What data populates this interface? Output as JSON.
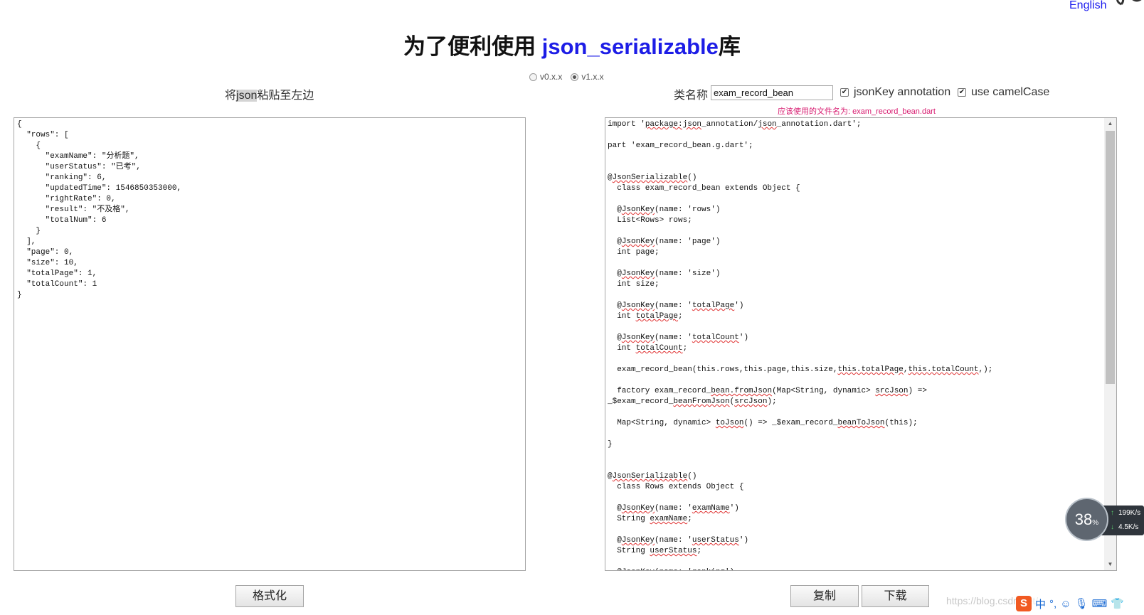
{
  "header": {
    "language_link": "English",
    "title_prefix": "为了便利使用 ",
    "title_highlight": "json_serializable",
    "title_suffix": "库"
  },
  "version": {
    "options": [
      "v0.x.x",
      "v1.x.x"
    ],
    "selected": "v1.x.x"
  },
  "left": {
    "label_prefix": "将",
    "label_mark": "json",
    "label_suffix": "粘贴至左边",
    "json_text": "{\n  \"rows\": [\n    {\n      \"examName\": \"分析题\",\n      \"userStatus\": \"已考\",\n      \"ranking\": 6,\n      \"updatedTime\": 1546850353000,\n      \"rightRate\": 0,\n      \"result\": \"不及格\",\n      \"totalNum\": 6\n    }\n  ],\n  \"page\": 0,\n  \"size\": 10,\n  \"totalPage\": 1,\n  \"totalCount\": 1\n}",
    "format_button": "格式化"
  },
  "right": {
    "classname_label": "类名称",
    "classname_value": "exam_record_bean",
    "jsonkey_label": "jsonKey annotation",
    "jsonkey_checked": true,
    "camelcase_label": "use camelCase",
    "camelcase_checked": true,
    "filename_hint": "应该使用的文件名为: exam_record_bean.dart",
    "copy_button": "复制",
    "download_button": "下载"
  },
  "speed_widget": {
    "percent": "38",
    "percent_unit": "%",
    "upload": "199K/s",
    "download": "4.5K/s"
  },
  "watermark": "https://blog.csdn.net/",
  "ime": {
    "logo": "S",
    "mode": "中",
    "punct": "°,"
  }
}
